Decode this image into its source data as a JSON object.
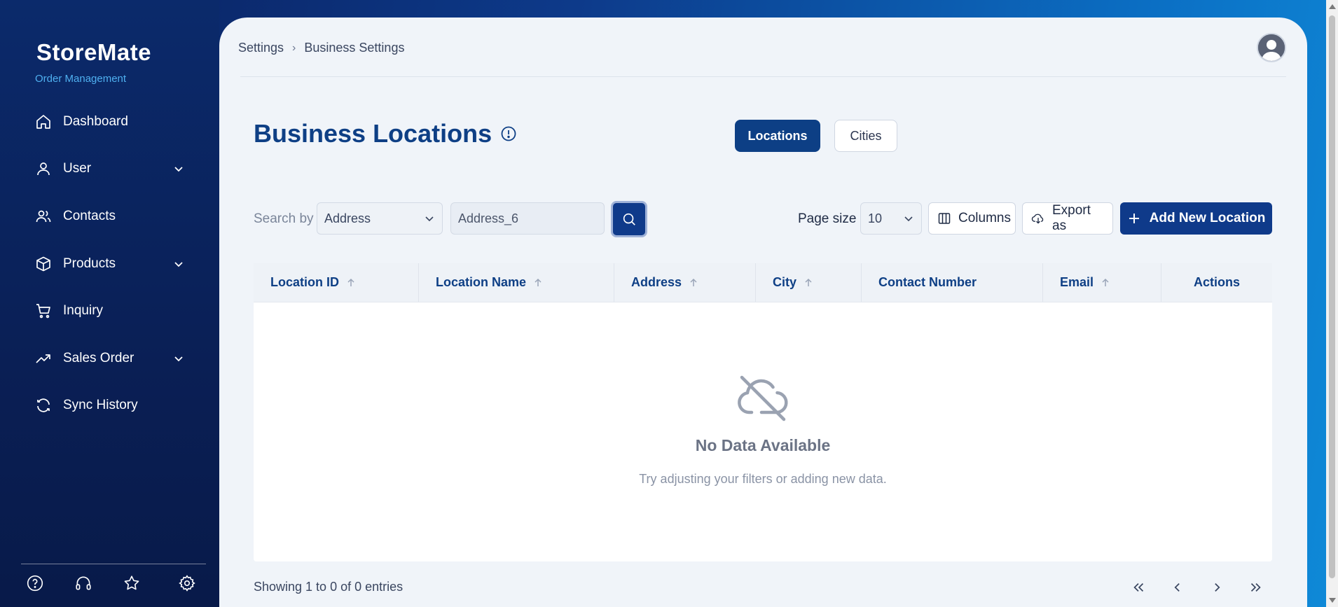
{
  "brand": {
    "name": "StoreMate",
    "subtitle": "Order Management"
  },
  "sidebar": {
    "items": [
      {
        "label": "Dashboard",
        "icon": "home-icon",
        "expandable": false
      },
      {
        "label": "User",
        "icon": "user-icon",
        "expandable": true
      },
      {
        "label": "Contacts",
        "icon": "users-icon",
        "expandable": false
      },
      {
        "label": "Products",
        "icon": "box-icon",
        "expandable": true
      },
      {
        "label": "Inquiry",
        "icon": "cart-icon",
        "expandable": false
      },
      {
        "label": "Sales Order",
        "icon": "trending-up-icon",
        "expandable": true
      },
      {
        "label": "Sync History",
        "icon": "refresh-icon",
        "expandable": false
      }
    ],
    "bottom_icons": [
      "help-icon",
      "headset-icon",
      "star-icon",
      "settings-icon"
    ]
  },
  "breadcrumb": {
    "first": "Settings",
    "separator": "›",
    "second": "Business Settings"
  },
  "page": {
    "title": "Business Locations"
  },
  "tabs": {
    "locations": "Locations",
    "cities": "Cities",
    "active": "Locations"
  },
  "toolbar": {
    "search_by_label": "Search by",
    "search_by_value": "Address",
    "search_value": "Address_6",
    "page_size_label": "Page size",
    "page_size_value": "10",
    "columns_label": "Columns",
    "export_label": "Export as",
    "add_label": "Add New Location"
  },
  "table": {
    "columns": [
      {
        "label": "Location ID",
        "sortable": true
      },
      {
        "label": "Location Name",
        "sortable": true
      },
      {
        "label": "Address",
        "sortable": true
      },
      {
        "label": "City",
        "sortable": true
      },
      {
        "label": "Contact Number",
        "sortable": false
      },
      {
        "label": "Email",
        "sortable": true
      },
      {
        "label": "Actions",
        "sortable": false
      }
    ],
    "rows": [],
    "empty_title": "No Data Available",
    "empty_desc": "Try adjusting your filters or adding new data."
  },
  "footer": {
    "info": "Showing 1 to 0 of 0 entries"
  },
  "colors": {
    "primary": "#0d3f85",
    "title": "#0e3f85",
    "accent": "#4fb0f0"
  }
}
